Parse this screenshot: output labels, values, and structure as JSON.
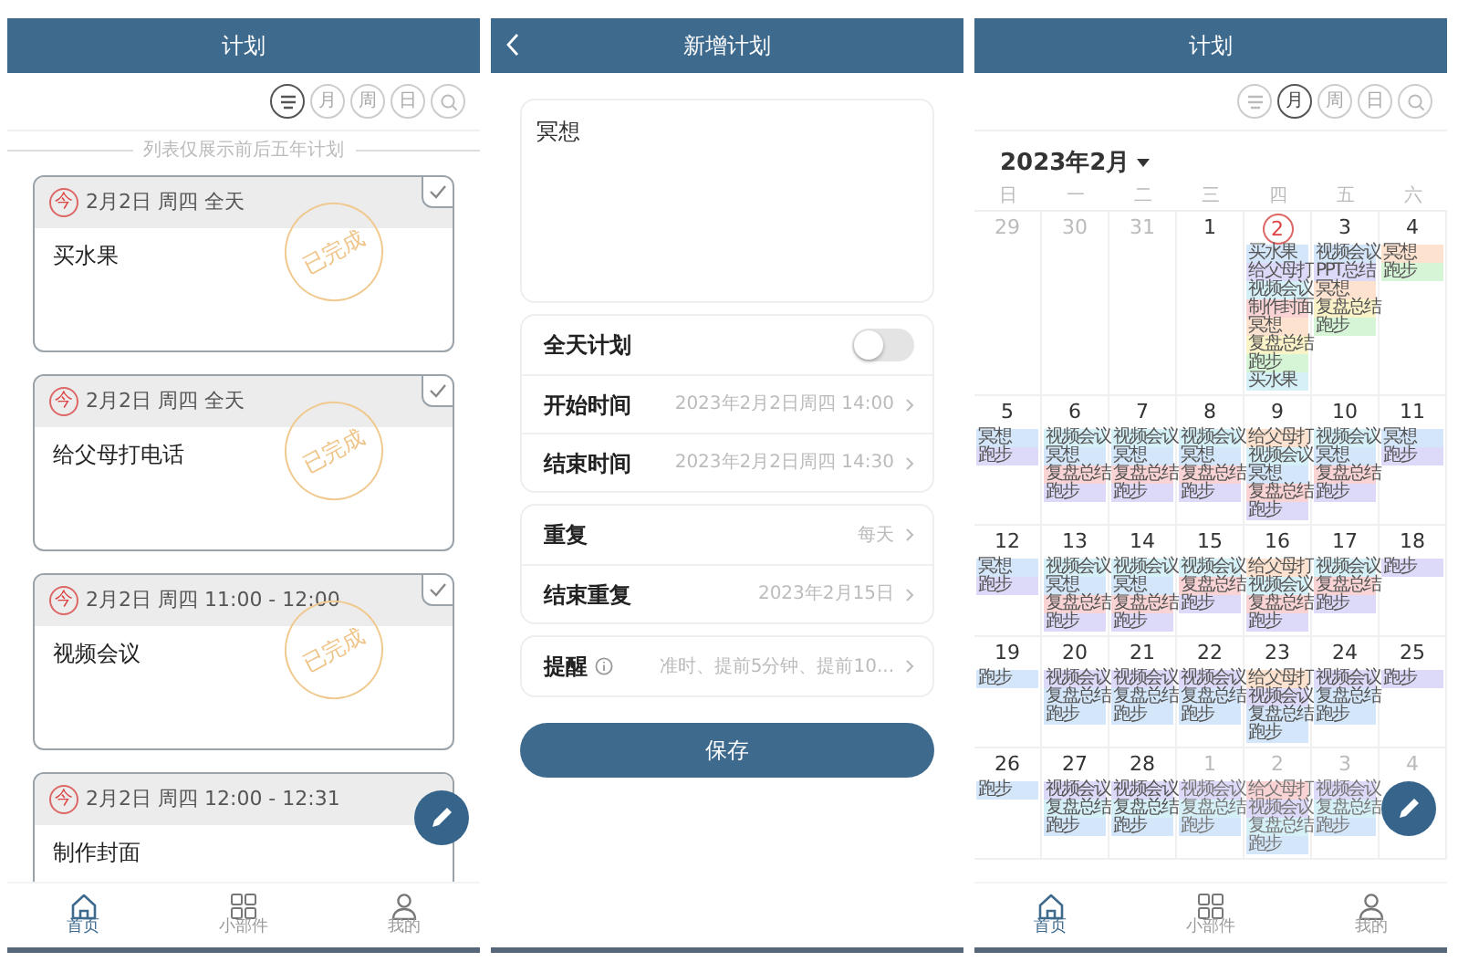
{
  "list_screen": {
    "title": "计划",
    "views": [
      {
        "kind": "list",
        "selected": true
      },
      {
        "kind": "text",
        "label": "月",
        "selected": false
      },
      {
        "kind": "text",
        "label": "周",
        "selected": false
      },
      {
        "kind": "text",
        "label": "日",
        "selected": false
      },
      {
        "kind": "search",
        "selected": false
      }
    ],
    "caption": "列表仅展示前后五年计划",
    "cards": [
      {
        "today_mark": "今",
        "when": "2月2日 周四 全天",
        "title": "买水果",
        "done": true,
        "stamp": "已完成"
      },
      {
        "today_mark": "今",
        "when": "2月2日 周四 全天",
        "title": "给父母打电话",
        "done": true,
        "stamp": "已完成"
      },
      {
        "today_mark": "今",
        "when": "2月2日 周四 11:00 - 12:00",
        "title": "视频会议",
        "done": true,
        "stamp": "已完成"
      },
      {
        "today_mark": "今",
        "when": "2月2日 周四 12:00 - 12:31",
        "title": "制作封面",
        "done": false
      }
    ],
    "nav": [
      {
        "kind": "home",
        "label": "首页",
        "selected": true
      },
      {
        "kind": "widgets",
        "label": "小部件",
        "selected": false
      },
      {
        "kind": "user",
        "label": "我的",
        "selected": false
      }
    ]
  },
  "form_screen": {
    "title": "新增计划",
    "name_value": "冥想",
    "groups": [
      [
        {
          "kind": "toggle",
          "label": "全天计划",
          "on": false
        },
        {
          "kind": "link",
          "label": "开始时间",
          "value": "2023年2月2日周四 14:00"
        },
        {
          "kind": "link",
          "label": "结束时间",
          "value": "2023年2月2日周四 14:30"
        }
      ],
      [
        {
          "kind": "link",
          "label": "重复",
          "value": "每天"
        },
        {
          "kind": "link",
          "label": "结束重复",
          "value": "2023年2月15日"
        }
      ],
      [
        {
          "kind": "info_link",
          "label": "提醒",
          "value": "准时、提前5分钟、提前10..."
        }
      ]
    ],
    "save": "保存"
  },
  "calendar_screen": {
    "title": "计划",
    "views": [
      {
        "kind": "list",
        "selected": false
      },
      {
        "kind": "text",
        "label": "月",
        "selected": true
      },
      {
        "kind": "text",
        "label": "周",
        "selected": false
      },
      {
        "kind": "text",
        "label": "日",
        "selected": false
      },
      {
        "kind": "search",
        "selected": false
      }
    ],
    "month": "2023年2月",
    "weekdays": [
      "日",
      "一",
      "二",
      "三",
      "四",
      "五",
      "六"
    ],
    "weeks": [
      [
        {
          "day": "29",
          "other_month": true,
          "today": false
        },
        {
          "day": "30",
          "other_month": true,
          "today": false
        },
        {
          "day": "31",
          "other_month": true,
          "today": false
        },
        {
          "day": "1",
          "other_month": false,
          "today": false
        },
        {
          "day": "2",
          "other_month": false,
          "today": true,
          "events": [
            {
              "text": "买水果",
              "color": "#d4e6f9"
            },
            {
              "text": "给父母打",
              "color": "#ddd9f8"
            },
            {
              "text": "视频会议",
              "color": "#d5f0f7"
            },
            {
              "text": "制作封面",
              "color": "#fad4d4"
            },
            {
              "text": "冥想",
              "color": "#fde3cf"
            },
            {
              "text": "复盘总结",
              "color": "#fbf3c8"
            },
            {
              "text": "跑步",
              "color": "#d6f5d6"
            },
            {
              "text": "买水果",
              "color": "#d5f0f7"
            }
          ]
        },
        {
          "day": "3",
          "other_month": false,
          "today": false,
          "events": [
            {
              "text": "视频会议",
              "color": "#d4e6f9"
            },
            {
              "text": "PPT总结",
              "color": "#ddd9f8"
            },
            {
              "text": "冥想",
              "color": "#fde3cf"
            },
            {
              "text": "复盘总结",
              "color": "#fbf3c8"
            },
            {
              "text": "跑步",
              "color": "#d6f5d6"
            }
          ]
        },
        {
          "day": "4",
          "other_month": false,
          "today": false,
          "events": [
            {
              "text": "冥想",
              "color": "#fde3cf"
            },
            {
              "text": "跑步",
              "color": "#d6f5d6"
            }
          ]
        }
      ],
      [
        {
          "day": "5",
          "other_month": false,
          "today": false,
          "events": [
            {
              "text": "冥想",
              "color": "#d4e6f9"
            },
            {
              "text": "跑步",
              "color": "#ddd9f8"
            }
          ]
        },
        {
          "day": "6",
          "other_month": false,
          "today": false,
          "events": [
            {
              "text": "视频会议",
              "color": "#d5f0f7"
            },
            {
              "text": "冥想",
              "color": "#d4e6f9"
            },
            {
              "text": "复盘总结",
              "color": "#fad4d4"
            },
            {
              "text": "跑步",
              "color": "#ddd9f8"
            }
          ]
        },
        {
          "day": "7",
          "other_month": false,
          "today": false,
          "events": [
            {
              "text": "视频会议",
              "color": "#d5f0f7"
            },
            {
              "text": "冥想",
              "color": "#d4e6f9"
            },
            {
              "text": "复盘总结",
              "color": "#fad4d4"
            },
            {
              "text": "跑步",
              "color": "#ddd9f8"
            }
          ]
        },
        {
          "day": "8",
          "other_month": false,
          "today": false,
          "events": [
            {
              "text": "视频会议",
              "color": "#d5f0f7"
            },
            {
              "text": "冥想",
              "color": "#d4e6f9"
            },
            {
              "text": "复盘总结",
              "color": "#fad4d4"
            },
            {
              "text": "跑步",
              "color": "#ddd9f8"
            }
          ]
        },
        {
          "day": "9",
          "other_month": false,
          "today": false,
          "events": [
            {
              "text": "给父母打",
              "color": "#fde3cf"
            },
            {
              "text": "视频会议",
              "color": "#d5f0f7"
            },
            {
              "text": "冥想",
              "color": "#d4e6f9"
            },
            {
              "text": "复盘总结",
              "color": "#fad4d4"
            },
            {
              "text": "跑步",
              "color": "#ddd9f8"
            }
          ]
        },
        {
          "day": "10",
          "other_month": false,
          "today": false,
          "events": [
            {
              "text": "视频会议",
              "color": "#d5f0f7"
            },
            {
              "text": "冥想",
              "color": "#d4e6f9"
            },
            {
              "text": "复盘总结",
              "color": "#fad4d4"
            },
            {
              "text": "跑步",
              "color": "#ddd9f8"
            }
          ]
        },
        {
          "day": "11",
          "other_month": false,
          "today": false,
          "events": [
            {
              "text": "冥想",
              "color": "#d4e6f9"
            },
            {
              "text": "跑步",
              "color": "#ddd9f8"
            }
          ]
        }
      ],
      [
        {
          "day": "12",
          "other_month": false,
          "today": false,
          "events": [
            {
              "text": "冥想",
              "color": "#d4e6f9"
            },
            {
              "text": "跑步",
              "color": "#ddd9f8"
            }
          ]
        },
        {
          "day": "13",
          "other_month": false,
          "today": false,
          "events": [
            {
              "text": "视频会议",
              "color": "#d5f0f7"
            },
            {
              "text": "冥想",
              "color": "#d4e6f9"
            },
            {
              "text": "复盘总结",
              "color": "#fad4d4"
            },
            {
              "text": "跑步",
              "color": "#ddd9f8"
            }
          ]
        },
        {
          "day": "14",
          "other_month": false,
          "today": false,
          "events": [
            {
              "text": "视频会议",
              "color": "#d5f0f7"
            },
            {
              "text": "冥想",
              "color": "#d4e6f9"
            },
            {
              "text": "复盘总结",
              "color": "#fad4d4"
            },
            {
              "text": "跑步",
              "color": "#ddd9f8"
            }
          ]
        },
        {
          "day": "15",
          "other_month": false,
          "today": false,
          "events": [
            {
              "text": "视频会议",
              "color": "#d5f0f7"
            },
            {
              "text": "复盘总结",
              "color": "#fad4d4"
            },
            {
              "text": "跑步",
              "color": "#ddd9f8"
            }
          ]
        },
        {
          "day": "16",
          "other_month": false,
          "today": false,
          "events": [
            {
              "text": "给父母打",
              "color": "#fde3cf"
            },
            {
              "text": "视频会议",
              "color": "#d5f0f7"
            },
            {
              "text": "复盘总结",
              "color": "#fad4d4"
            },
            {
              "text": "跑步",
              "color": "#ddd9f8"
            }
          ]
        },
        {
          "day": "17",
          "other_month": false,
          "today": false,
          "events": [
            {
              "text": "视频会议",
              "color": "#d5f0f7"
            },
            {
              "text": "复盘总结",
              "color": "#fad4d4"
            },
            {
              "text": "跑步",
              "color": "#ddd9f8"
            }
          ]
        },
        {
          "day": "18",
          "other_month": false,
          "today": false,
          "events": [
            {
              "text": "跑步",
              "color": "#ddd9f8"
            }
          ]
        }
      ],
      [
        {
          "day": "19",
          "other_month": false,
          "today": false,
          "events": [
            {
              "text": "跑步",
              "color": "#d4e6f9"
            }
          ]
        },
        {
          "day": "20",
          "other_month": false,
          "today": false,
          "events": [
            {
              "text": "视频会议",
              "color": "#ddd9f8"
            },
            {
              "text": "复盘总结",
              "color": "#d4e6f9"
            },
            {
              "text": "跑步",
              "color": "#d4e6f9"
            }
          ]
        },
        {
          "day": "21",
          "other_month": false,
          "today": false,
          "events": [
            {
              "text": "视频会议",
              "color": "#ddd9f8"
            },
            {
              "text": "复盘总结",
              "color": "#d4e6f9"
            },
            {
              "text": "跑步",
              "color": "#d4e6f9"
            }
          ]
        },
        {
          "day": "22",
          "other_month": false,
          "today": false,
          "events": [
            {
              "text": "视频会议",
              "color": "#ddd9f8"
            },
            {
              "text": "复盘总结",
              "color": "#d4e6f9"
            },
            {
              "text": "跑步",
              "color": "#d4e6f9"
            }
          ]
        },
        {
          "day": "23",
          "other_month": false,
          "today": false,
          "events": [
            {
              "text": "给父母打",
              "color": "#fde3cf"
            },
            {
              "text": "视频会议",
              "color": "#ddd9f8"
            },
            {
              "text": "复盘总结",
              "color": "#d4e6f9"
            },
            {
              "text": "跑步",
              "color": "#d4e6f9"
            }
          ]
        },
        {
          "day": "24",
          "other_month": false,
          "today": false,
          "events": [
            {
              "text": "视频会议",
              "color": "#ddd9f8"
            },
            {
              "text": "复盘总结",
              "color": "#d4e6f9"
            },
            {
              "text": "跑步",
              "color": "#d4e6f9"
            }
          ]
        },
        {
          "day": "25",
          "other_month": false,
          "today": false,
          "events": [
            {
              "text": "跑步",
              "color": "#ddd9f8"
            }
          ]
        }
      ],
      [
        {
          "day": "26",
          "other_month": false,
          "today": false,
          "events": [
            {
              "text": "跑步",
              "color": "#d4e6f9"
            }
          ]
        },
        {
          "day": "27",
          "other_month": false,
          "today": false,
          "events": [
            {
              "text": "视频会议",
              "color": "#ddd9f8"
            },
            {
              "text": "复盘总结",
              "color": "#d5f0f7"
            },
            {
              "text": "跑步",
              "color": "#d4e6f9"
            }
          ]
        },
        {
          "day": "28",
          "other_month": false,
          "today": false,
          "events": [
            {
              "text": "视频会议",
              "color": "#ddd9f8"
            },
            {
              "text": "复盘总结",
              "color": "#d5f0f7"
            },
            {
              "text": "跑步",
              "color": "#d4e6f9"
            }
          ]
        },
        {
          "day": "1",
          "other_month": true,
          "today": false,
          "events": [
            {
              "text": "视频会议",
              "color": "#ddd9f8"
            },
            {
              "text": "复盘总结",
              "color": "#d5f0f7"
            },
            {
              "text": "跑步",
              "color": "#d4e6f9"
            }
          ]
        },
        {
          "day": "2",
          "other_month": true,
          "today": false,
          "events": [
            {
              "text": "给父母打",
              "color": "#fad4d4"
            },
            {
              "text": "视频会议",
              "color": "#ddd9f8"
            },
            {
              "text": "复盘总结",
              "color": "#d5f0f7"
            },
            {
              "text": "跑步",
              "color": "#d4e6f9"
            }
          ]
        },
        {
          "day": "3",
          "other_month": true,
          "today": false,
          "events": [
            {
              "text": "视频会议",
              "color": "#ddd9f8"
            },
            {
              "text": "复盘总结",
              "color": "#d5f0f7"
            },
            {
              "text": "跑步",
              "color": "#d4e6f9"
            }
          ]
        },
        {
          "day": "4",
          "other_month": true,
          "today": false
        }
      ]
    ],
    "nav": [
      {
        "kind": "home",
        "label": "首页",
        "selected": true
      },
      {
        "kind": "widgets",
        "label": "小部件",
        "selected": false
      },
      {
        "kind": "user",
        "label": "我的",
        "selected": false
      }
    ]
  }
}
